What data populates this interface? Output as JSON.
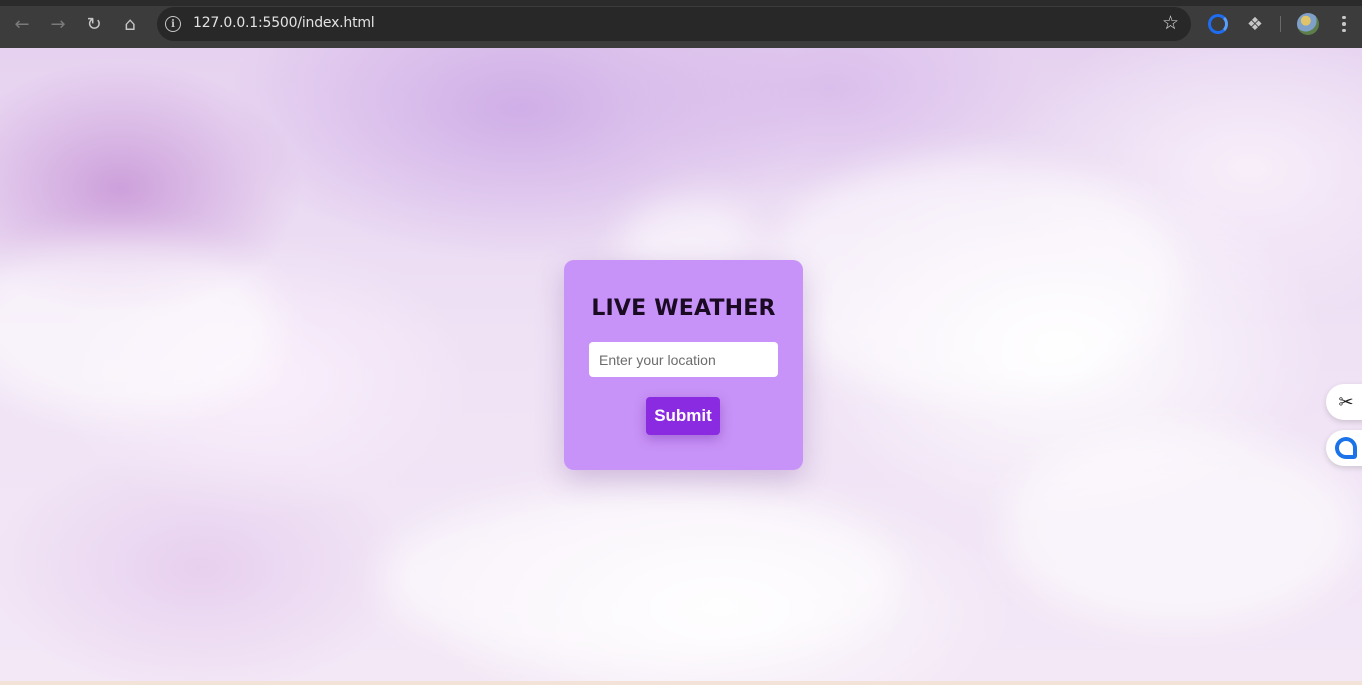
{
  "browser": {
    "url": "127.0.0.1:5500/index.html",
    "icons": {
      "back": "arrow-left",
      "forward": "arrow-right",
      "reload": "reload",
      "home": "home",
      "site_info": "info",
      "bookmark": "star",
      "extension_1": "blue-ring-extension",
      "extensions": "puzzle",
      "profile": "avatar",
      "menu": "kebab-menu"
    }
  },
  "app": {
    "title": "LIVE WEATHER",
    "search": {
      "placeholder": "Enter your location",
      "value": ""
    },
    "submit_label": "Submit"
  },
  "colors": {
    "card_background": "#c893f8",
    "button_background": "#8a2be2",
    "button_text": "#ffffff",
    "title_text": "#1a0a22"
  },
  "side_tools": {
    "icons": [
      "scissors",
      "chat"
    ]
  }
}
